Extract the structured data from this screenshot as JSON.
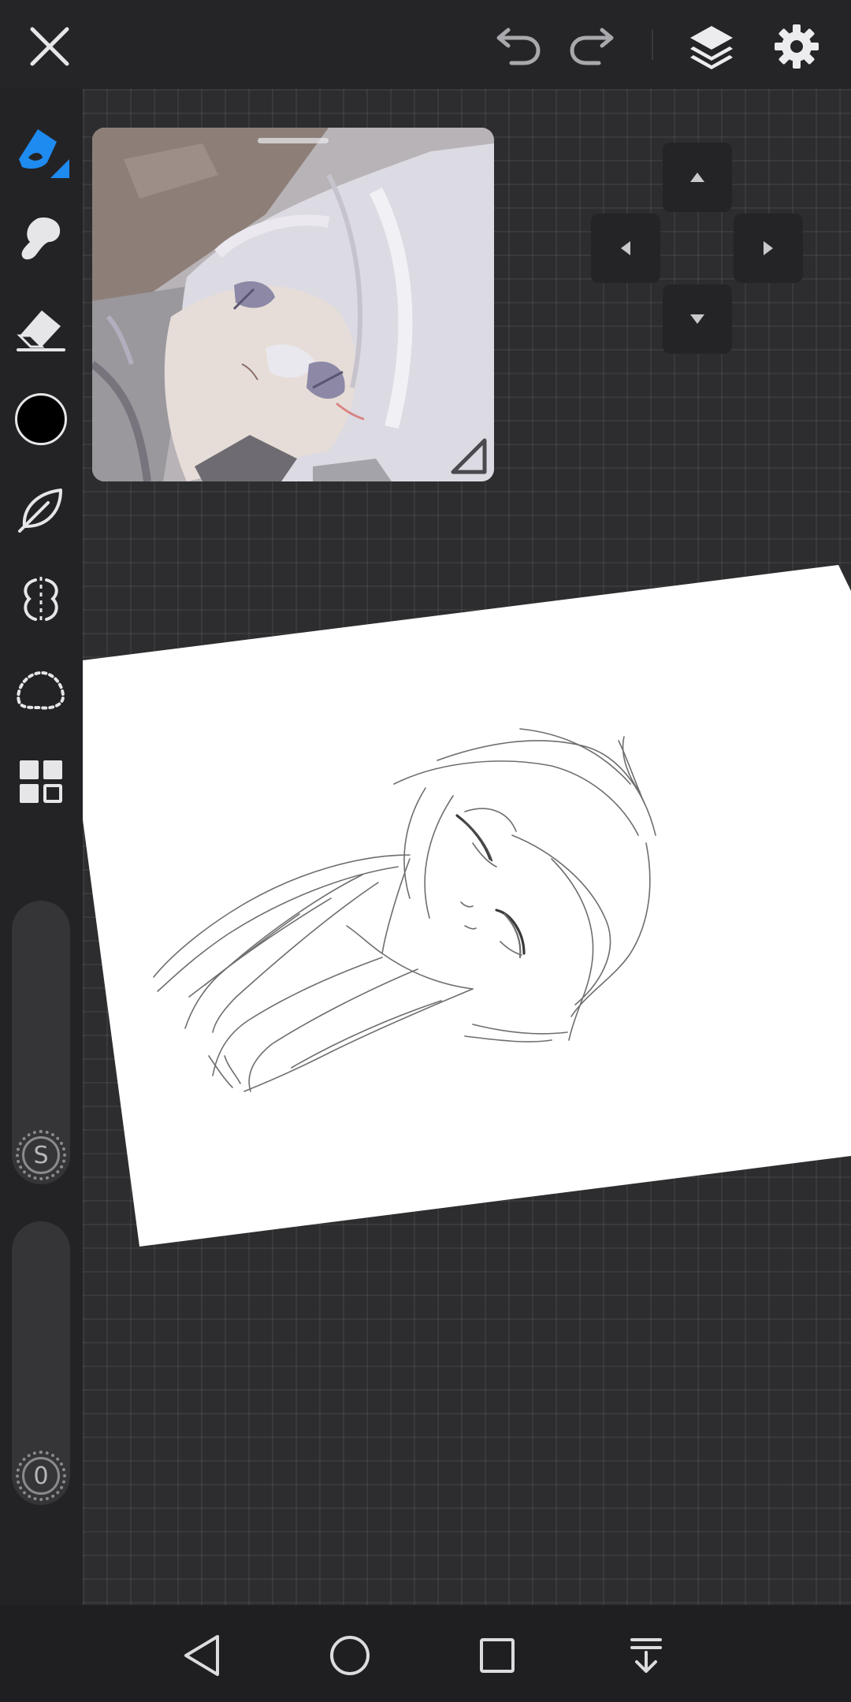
{
  "app": {
    "accent_color": "#1e8bf0"
  },
  "topbar": {
    "icons": [
      "close-icon",
      "undo-icon",
      "redo-icon",
      "layers-icon",
      "gear-icon"
    ]
  },
  "toolbar": {
    "tools": [
      "pen-icon",
      "smudge-icon",
      "eraser-icon",
      "color-swatch",
      "brush-icon",
      "symmetry-icon",
      "lasso-icon",
      "gallery-icon"
    ],
    "current_color": "#000000",
    "size_slider": {
      "label": "S",
      "level": 0
    },
    "opacity_slider": {
      "label": "0",
      "level": 0
    }
  },
  "reference_panel": {
    "description_icon": "reference-image"
  },
  "dpad": {
    "icons": [
      "arrow-up-icon",
      "arrow-left-icon",
      "arrow-right-icon",
      "arrow-down-icon"
    ]
  },
  "navbar": {
    "icons": [
      "nav-back-icon",
      "nav-home-icon",
      "nav-recents-icon",
      "nav-notification-icon"
    ]
  }
}
